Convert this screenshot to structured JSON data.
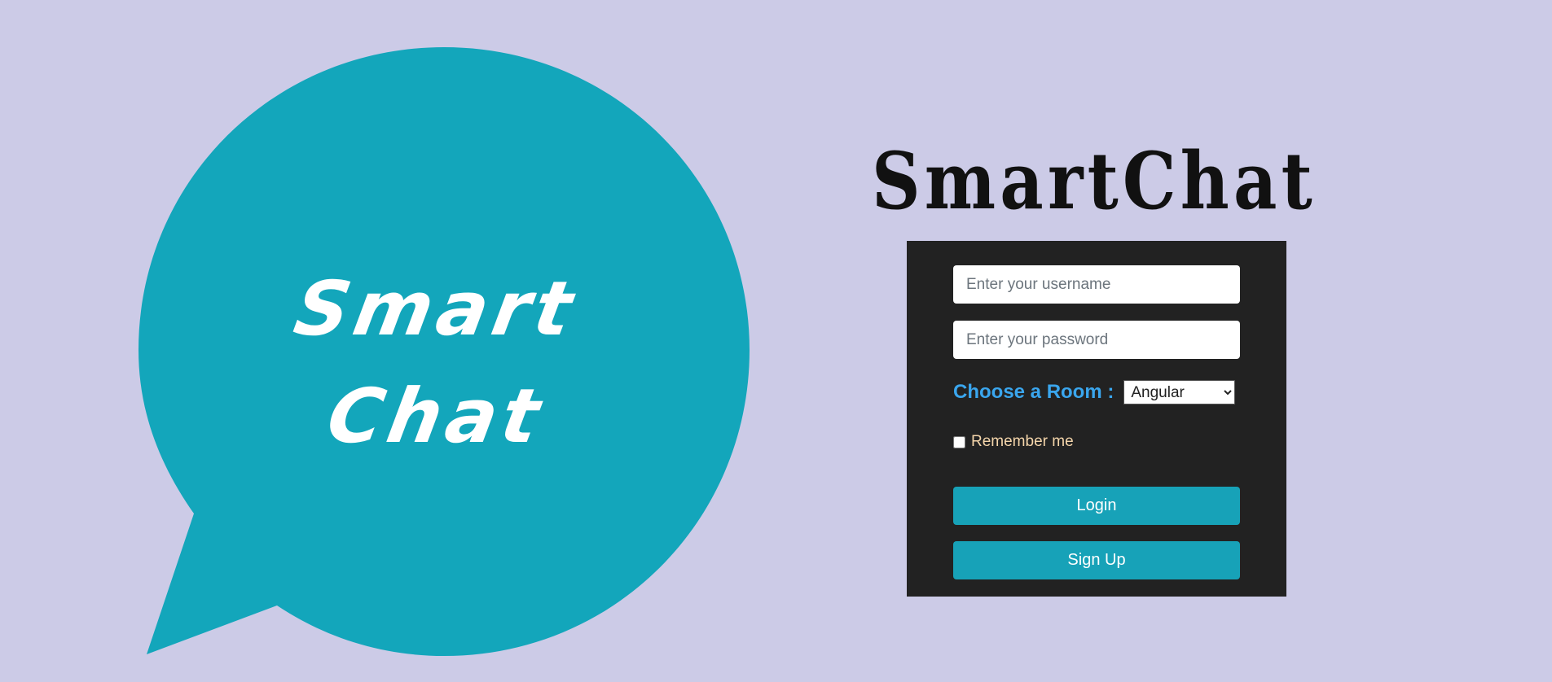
{
  "logo": {
    "line1": "Smart",
    "line2": "Chat",
    "bubble_color": "#13a6bb"
  },
  "brand": {
    "title": "SmartChat"
  },
  "login_form": {
    "username_placeholder": "Enter your username",
    "password_placeholder": "Enter your password",
    "room_label": "Choose a Room :",
    "room_selected": "Angular",
    "remember_label": "Remember me",
    "remember_checked": false,
    "login_label": "Login",
    "signup_label": "Sign Up"
  },
  "colors": {
    "background": "#cccbe7",
    "panel": "#222222",
    "accent": "#17a2b8",
    "room_label": "#3aa6ee",
    "remember_label": "#f5d6ab"
  }
}
